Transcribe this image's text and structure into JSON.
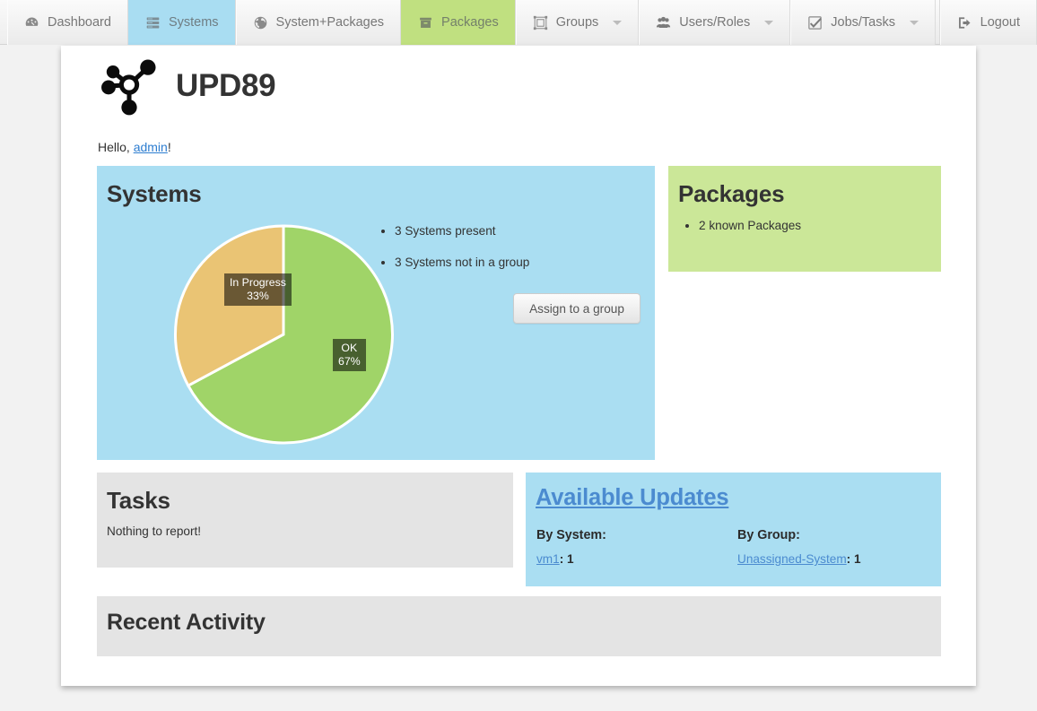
{
  "navbar": {
    "items": [
      {
        "label": "Dashboard",
        "icon": "dashboard-icon",
        "state": "default",
        "caret": false
      },
      {
        "label": "Systems",
        "icon": "server-icon",
        "state": "active-blue",
        "caret": false
      },
      {
        "label": "System+Packages",
        "icon": "globe-icon",
        "state": "default",
        "caret": false
      },
      {
        "label": "Packages",
        "icon": "archive-box-icon",
        "state": "active-green",
        "caret": false
      },
      {
        "label": "Groups",
        "icon": "object-group-icon",
        "state": "default",
        "caret": true
      },
      {
        "label": "Users/Roles",
        "icon": "users-icon",
        "state": "default",
        "caret": true
      },
      {
        "label": "Jobs/Tasks",
        "icon": "check-square-icon",
        "state": "default",
        "caret": true
      }
    ],
    "logout": {
      "label": "Logout",
      "icon": "sign-out-icon"
    }
  },
  "brand": {
    "title": "UPD89",
    "logo_icon": "network-nodes-logo"
  },
  "greeting": {
    "prefix": "Hello, ",
    "user": "admin",
    "suffix": "!"
  },
  "systems_panel": {
    "title": "Systems",
    "bullets": [
      "3 Systems present",
      "3 Systems not in a group"
    ],
    "assign_button": "Assign to a group"
  },
  "packages_panel": {
    "title": "Packages",
    "bullets": [
      "2 known Packages"
    ]
  },
  "tasks_panel": {
    "title": "Tasks",
    "body": "Nothing to report!"
  },
  "updates_panel": {
    "title": "Available Updates",
    "by_system": {
      "heading": "By System:",
      "rows": [
        {
          "name": "vm1",
          "separator": ": ",
          "count": "1"
        }
      ]
    },
    "by_group": {
      "heading": "By Group:",
      "rows": [
        {
          "name": "Unassigned-System",
          "separator": ": ",
          "count": "1"
        }
      ]
    }
  },
  "recent_panel": {
    "title": "Recent Activity"
  },
  "colors": {
    "panel_blue": "#aadef2",
    "panel_green": "#cbe798",
    "panel_grey": "#e4e4e4",
    "link_blue": "#4b8bd0",
    "pie_ok": "#a0d468",
    "pie_in_progress": "#eac474",
    "tab_active_blue": "#a9ddf2",
    "tab_active_green": "#c0e080"
  },
  "chart_data": {
    "type": "pie",
    "title": "Systems",
    "categories": [
      "OK",
      "In Progress"
    ],
    "values": [
      67,
      33
    ],
    "value_unit": "%",
    "labels": [
      "OK\n67%",
      "In Progress\n33%"
    ],
    "colors": [
      "#a0d468",
      "#eac474"
    ],
    "start_angle_deg": 0,
    "direction": "clockwise",
    "legend": "none",
    "label_placement": "inside-slice",
    "slice_border": "#ffffff"
  }
}
